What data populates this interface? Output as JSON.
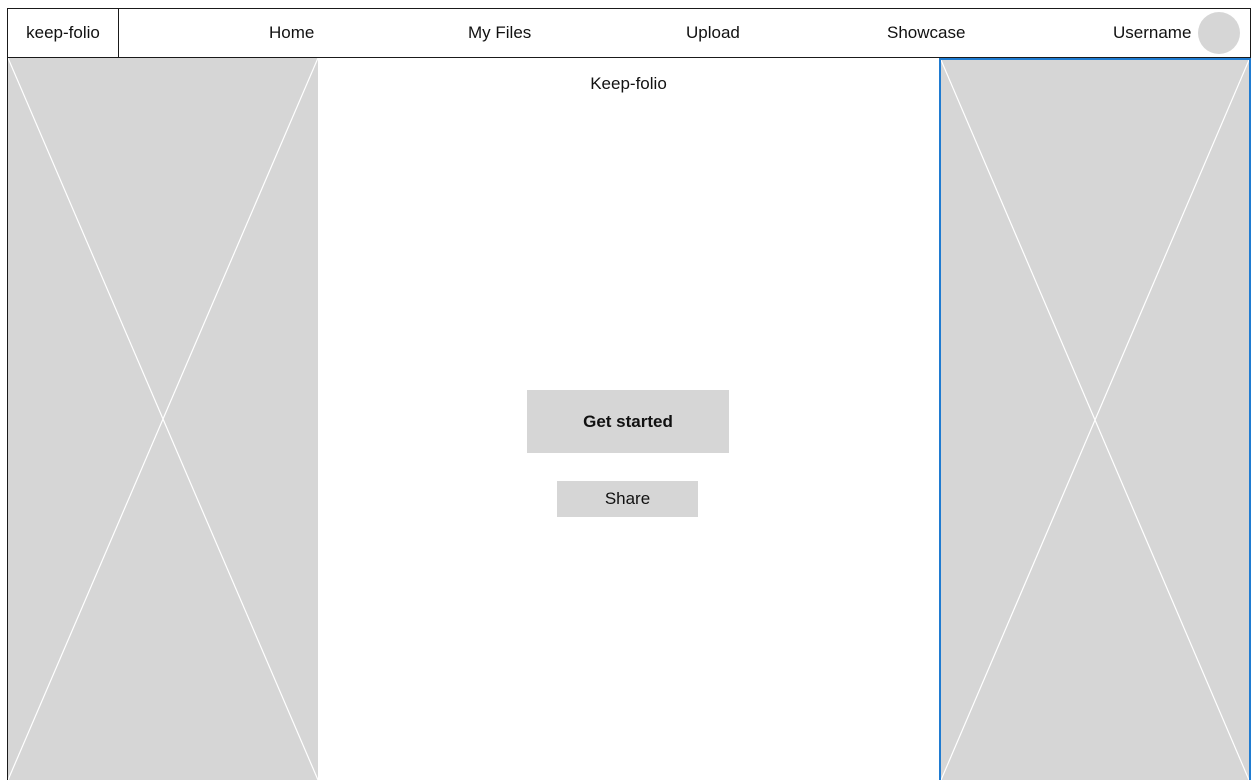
{
  "header": {
    "brand": "keep-folio",
    "nav": {
      "home": "Home",
      "my_files": "My Files",
      "upload": "Upload",
      "showcase": "Showcase",
      "username": "Username"
    }
  },
  "main": {
    "title": "Keep-folio",
    "get_started_label": "Get started",
    "share_label": "Share"
  },
  "colors": {
    "placeholder_fill": "#d6d6d6",
    "selection_border": "#1f7bd1",
    "button_fill": "#d6d6d6",
    "text": "#111111"
  }
}
